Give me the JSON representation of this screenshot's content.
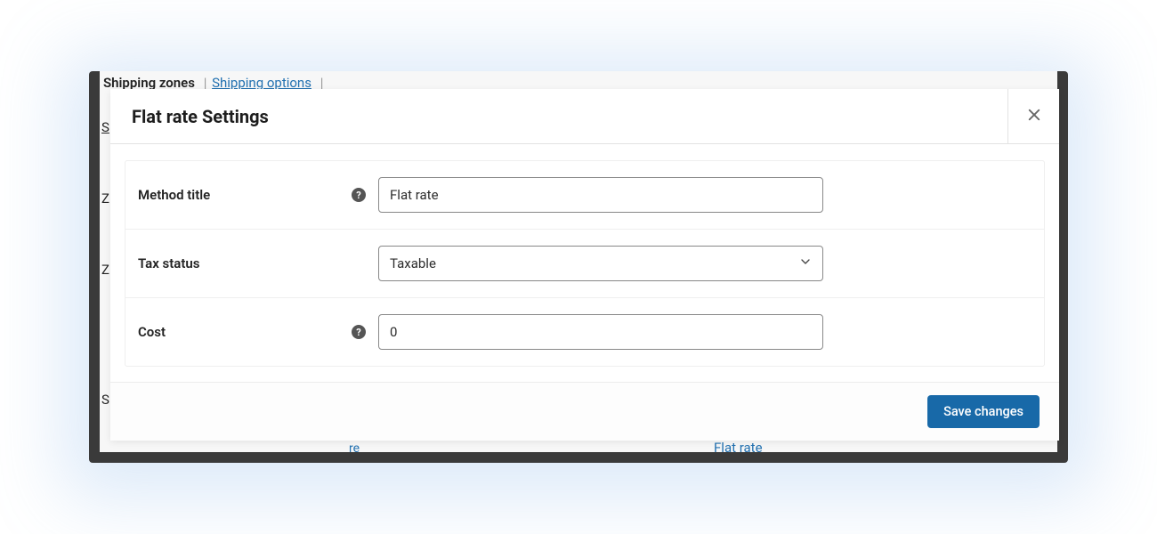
{
  "background": {
    "tabs": {
      "shipping_zones": "Shipping zones",
      "shipping_options": "Shipping options"
    },
    "side_s": "S",
    "side_z1": "Z",
    "side_z2": "Z",
    "side_sl": "S",
    "bottom_text": "Flat rate",
    "bottom_small": "re"
  },
  "modal": {
    "title": "Flat rate Settings",
    "footer": {
      "save_label": "Save changes"
    },
    "fields": {
      "method_title": {
        "label": "Method title",
        "value": "Flat rate",
        "has_help": true
      },
      "tax_status": {
        "label": "Tax status",
        "value": "Taxable",
        "has_help": false
      },
      "cost": {
        "label": "Cost",
        "value": "0",
        "has_help": true
      }
    }
  }
}
